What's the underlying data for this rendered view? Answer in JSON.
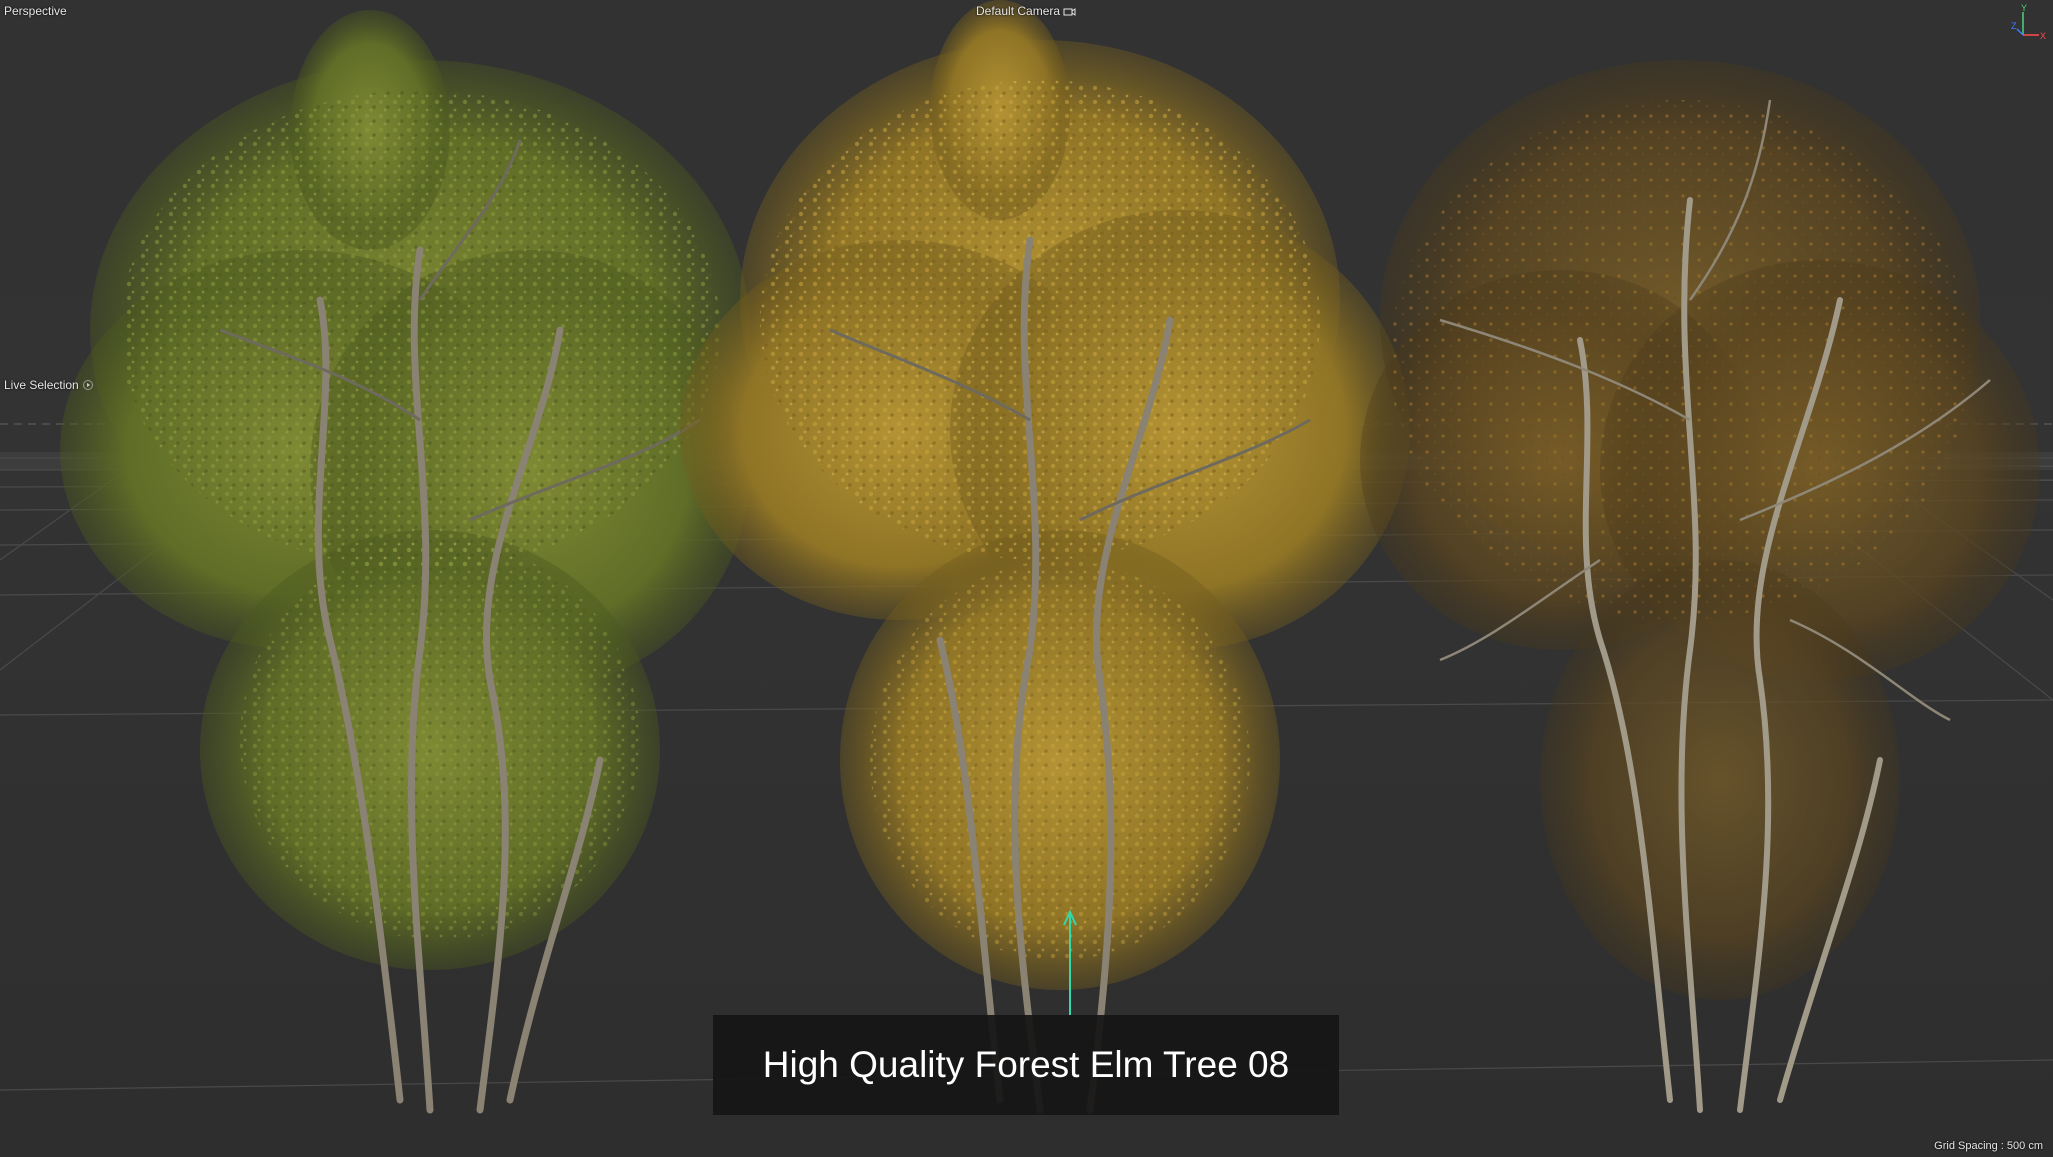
{
  "viewport": {
    "view_name": "Perspective",
    "camera_name": "Default Camera",
    "tool_name": "Live Selection",
    "grid_spacing": "Grid Spacing : 500 cm"
  },
  "axis_gizmo": {
    "y_label": "Y",
    "z_label": "Z",
    "x_label": "X",
    "y_color": "#4fd27a",
    "z_color": "#3f7bff",
    "x_color": "#ff4a4a"
  },
  "banner": {
    "title": "High Quality Forest Elm Tree 08"
  },
  "colors": {
    "background": "#333333",
    "grid_line": "#4a4a4a",
    "horizon_band": "#5a5a5a",
    "tree_left_foliage": "#6b7a2e",
    "tree_middle_foliage": "#a8892a",
    "tree_right_foliage": "#8a6a2a",
    "bark": "#8a8272",
    "manipulator": "#33d9a8"
  },
  "icons": {
    "camera": "camera-icon",
    "tool_arrow": "play-circle-icon"
  }
}
